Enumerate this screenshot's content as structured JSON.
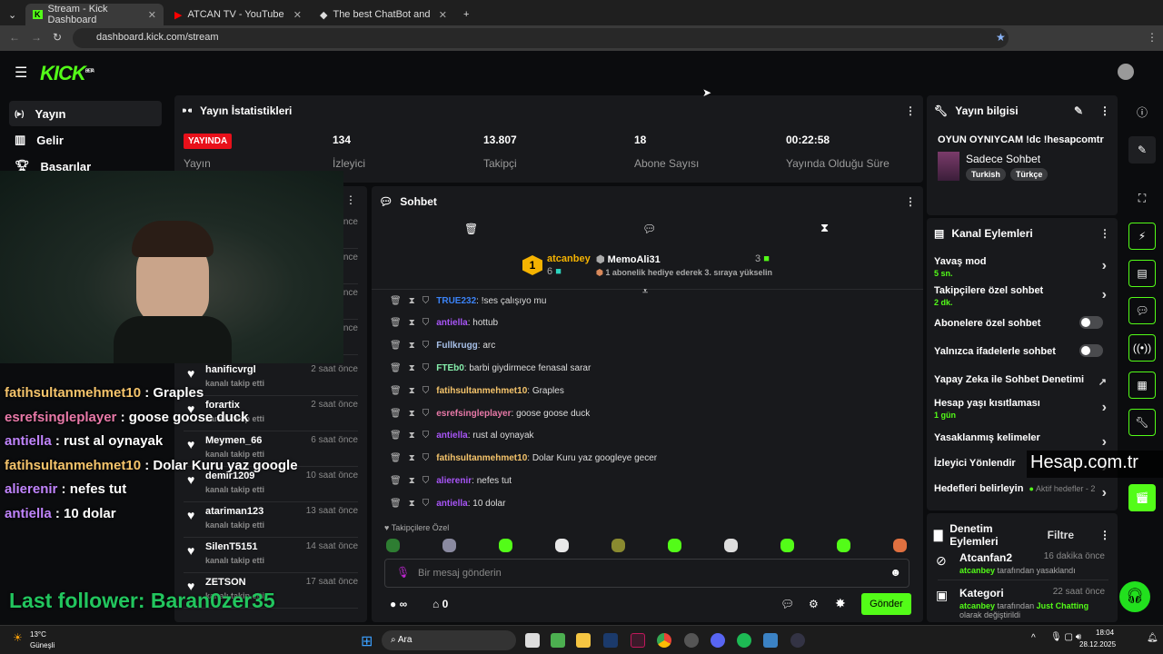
{
  "browser": {
    "tabs": [
      {
        "title": "Stream - Kick Dashboard",
        "active": true
      },
      {
        "title": "ATCAN TV - YouTube"
      },
      {
        "title": "The best ChatBot and Widgets"
      }
    ],
    "url": "dashboard.kick.com/stream"
  },
  "brand": {
    "logo": "KICK",
    "beta": "BETA",
    "accent": "#53fc18"
  },
  "sidebar": {
    "items": [
      {
        "label": "Yayın",
        "icon": "broadcast-icon"
      },
      {
        "label": "Gelir",
        "icon": "chart-icon"
      },
      {
        "label": "Basarılar",
        "icon": "trophy-icon"
      }
    ]
  },
  "stats": {
    "title": "Yayın İstatistikleri",
    "live_badge": "YAYINDA",
    "live_label": "Yayın",
    "items": [
      {
        "value": "134",
        "label": "İzleyici"
      },
      {
        "value": "13.807",
        "label": "Takipçi"
      },
      {
        "value": "18",
        "label": "Abone Sayısı"
      },
      {
        "value": "00:22:58",
        "label": "Yayında Olduğu Süre"
      }
    ]
  },
  "feed": [
    {
      "name": "hanificvrgl",
      "sub": "kanalı takip etti",
      "time": "2 saat önce"
    },
    {
      "name": "forartix",
      "sub": "kanalı takip etti",
      "time": "2 saat önce"
    },
    {
      "name": "Meymen_66",
      "sub": "kanalı takip etti",
      "time": "6 saat önce"
    },
    {
      "name": "demir1209",
      "sub": "kanalı takip etti",
      "time": "10 saat önce"
    },
    {
      "name": "atariman123",
      "sub": "kanalı takip etti",
      "time": "13 saat önce"
    },
    {
      "name": "SilenT5151",
      "sub": "kanalı takip etti",
      "time": "14 saat önce"
    },
    {
      "name": "ZETSON",
      "sub": "kanalı takip etti",
      "time": "17 saat önce"
    }
  ],
  "feed_partial_times": [
    "önce",
    "önce",
    "önce",
    "önce"
  ],
  "chat": {
    "title": "Sohbet",
    "leaderboard": {
      "first": {
        "rank": "1",
        "name": "atcanbey",
        "count": "6"
      },
      "second": {
        "name": "MemoAli31",
        "count": "3"
      },
      "hint": "1 abonelik hediye ederek 3. sıraya yükselin"
    },
    "messages": [
      {
        "user": "TRUE232",
        "color": "#3b82f6",
        "text": "!ses çalışıyo mu"
      },
      {
        "user": "antiella",
        "color": "#a855f7",
        "text": "hottub"
      },
      {
        "user": "Fullkrugg",
        "color": "#a7c0e8",
        "text": "arc"
      },
      {
        "user": "FTEb0",
        "color": "#86efac",
        "text": "barbi giydirmece fenasal sarar"
      },
      {
        "user": "fatihsultanmehmet10",
        "color": "#f5c46b",
        "text": "Graples"
      },
      {
        "user": "esrefsingleplayer",
        "color": "#e879a8",
        "text": "goose goose duck"
      },
      {
        "user": "antiella",
        "color": "#a855f7",
        "text": "rust al oynayak"
      },
      {
        "user": "fatihsultanmehmet10",
        "color": "#f5c46b",
        "text": "Dolar Kuru yaz googleye gecer"
      },
      {
        "user": "alierenir",
        "color": "#a855f7",
        "text": "nefes tut"
      },
      {
        "user": "antiella",
        "color": "#a855f7",
        "text": "10 dolar"
      }
    ],
    "emote_label": "Takipçilere Özel",
    "placeholder": "Bir mesaj gönderin",
    "points": "∞",
    "shop_count": "0",
    "send": "Gönder"
  },
  "stream_info": {
    "title": "Yayın bilgisi",
    "stream_title": "OYUN OYNIYCAM !dc !hesapcomtr",
    "category": "Sadece Sohbet",
    "tags": [
      "Turkish",
      "Türkçe"
    ]
  },
  "channel_actions": {
    "title": "Kanal Eylemleri",
    "rows": [
      {
        "label": "Yavaş mod",
        "sub": "5 sn.",
        "type": "chevron"
      },
      {
        "label": "Takipçilere özel sohbet",
        "sub": "2 dk.",
        "type": "chevron"
      },
      {
        "label": "Abonelere özel sohbet",
        "type": "toggle",
        "on": false
      },
      {
        "label": "Yalnızca ifadelerle sohbet",
        "type": "toggle",
        "on": false
      },
      {
        "label": "Yapay Zeka ile Sohbet Denetimi",
        "type": "external"
      },
      {
        "label": "Hesap yaşı kısıtlaması",
        "sub": "1 gün",
        "type": "chevron"
      },
      {
        "label": "Yasaklanmış kelimeler",
        "type": "chevron"
      },
      {
        "label": "İzleyici Yönlendir",
        "type": "chevron"
      },
      {
        "label": "Hedefleri belirleyin",
        "extra": "Aktif hedefler - 2",
        "type": "chevron"
      }
    ]
  },
  "mod_actions": {
    "title": "Denetim Eylemleri",
    "filter": "Filtre",
    "items": [
      {
        "title": "Atcanfan2",
        "time": "16 dakika önce",
        "by": "atcanbey",
        "action": "tarafından yasaklandı"
      },
      {
        "title": "Kategori",
        "time": "22 saat önce",
        "by": "atcanbey",
        "action": "tarafından",
        "target": "Just Chatting",
        "rest": "olarak değiştirildi"
      }
    ]
  },
  "watermark": "Hesap.com.tr",
  "overlay": {
    "lines": [
      {
        "user": "fatihsultanmehmet10",
        "color": "#f5c46b",
        "text": " : Graples"
      },
      {
        "user": "esrefsingleplayer",
        "color": "#e879a8",
        "text": " : goose goose duck"
      },
      {
        "user": "antiella",
        "color": "#c084fc",
        "text": " : rust al oynayak"
      },
      {
        "user": "fatihsultanmehmet10",
        "color": "#f5c46b",
        "text": " : Dolar Kuru yaz google"
      },
      {
        "user": "alierenir",
        "color": "#c084fc",
        "text": " : nefes tut"
      },
      {
        "user": "antiella",
        "color": "#c084fc",
        "text": " : 10 dolar"
      }
    ],
    "last_follower": "Last follower: Baran0zer35"
  },
  "taskbar": {
    "weather_temp": "13°C",
    "weather_desc": "Güneşli",
    "search": "Ara",
    "time": "18:04",
    "date": "28.12.2025"
  }
}
